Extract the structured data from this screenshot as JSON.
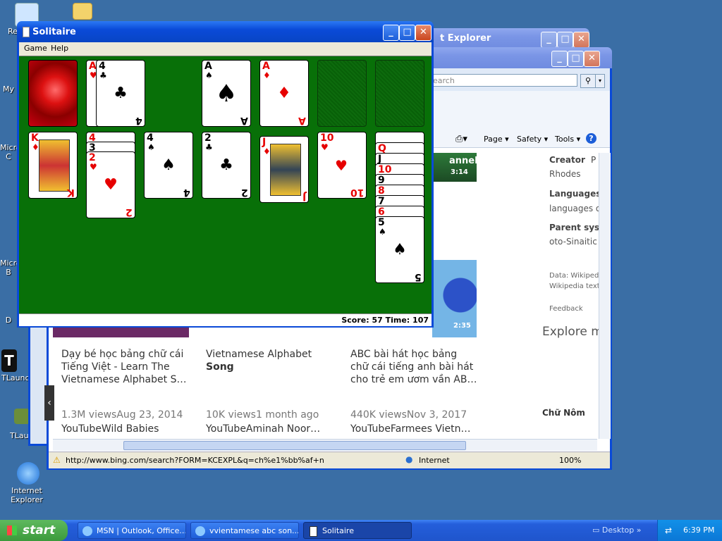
{
  "desktop": {
    "icons": [
      {
        "label": "Re"
      },
      {
        "label": "My"
      },
      {
        "label": "Micro C"
      },
      {
        "label": "Micro B"
      },
      {
        "label": "D"
      },
      {
        "label": "TLaunch"
      },
      {
        "label": "TLaunch"
      },
      {
        "label": "Internet Explorer"
      }
    ]
  },
  "ie_back": {
    "title": "t Explorer"
  },
  "ie_front": {
    "search_placeholder": "earch",
    "toolbar": {
      "page": "Page",
      "safety": "Safety",
      "tools": "Tools"
    },
    "side": {
      "creator_label": "Creator",
      "creator_value": "Rhodes",
      "creator_extra": "P",
      "languages_label": "Languages",
      "languages_value": "languages o",
      "parent_label": "Parent syst",
      "parent_value": "oto-Sinaitic",
      "data_line": "Data: Wikipedia",
      "wiki_line": "Wikipedia text",
      "feedback": "Feedback",
      "explore": "Explore m",
      "chu_nom": "Chữ Nôm"
    },
    "thumbs": [
      {
        "duration": "3:14",
        "text": "annel"
      },
      {
        "duration": "2:35"
      }
    ],
    "videos": [
      {
        "title1": "Dạy bé học bảng chữ cái",
        "title2": "Tiếng Việt - Learn The",
        "title3": "Vietnamese Alphabet S…",
        "meta": "1.3M viewsAug 23, 2014",
        "source": "YouTubeWild Babies"
      },
      {
        "title1": "Vietnamese Alphabet",
        "title2": "Song",
        "title3": "",
        "meta": "10K views1 month ago",
        "source": "YouTubeAminah Noor…"
      },
      {
        "title1": "ABC bài hát học bảng",
        "title2": "chữ cái tiếng anh bài hát",
        "title3": "cho trẻ em ươm vần AB…",
        "meta": "440K viewsNov 3, 2017",
        "source": "YouTubeFarmees Vietn…"
      }
    ],
    "status": {
      "url": "http://www.bing.com/search?FORM=KCEXPL&q=ch%e1%bb%af+n",
      "zone": "Internet",
      "zoom": "100%"
    }
  },
  "solitaire": {
    "title": "Solitaire",
    "menu": [
      "Game",
      "Help"
    ],
    "score": "Score: 57 Time: 107",
    "stock": {
      "top_rank": "A",
      "top_suit": "♥",
      "face_rank": "4",
      "face_suit": "♣"
    },
    "foundations": [
      {
        "rank": "A",
        "suit": "♠",
        "color": "#000000"
      },
      {
        "rank": "A",
        "suit": "♦",
        "color": "#e60000"
      }
    ],
    "tableau": [
      {
        "rank": "K",
        "suit": "♦",
        "color": "#e60000"
      },
      {
        "rank": "2",
        "suit": "♥",
        "color": "#e60000",
        "under": [
          "4",
          "3"
        ]
      },
      {
        "rank": "4",
        "suit": "♠",
        "color": "#000000"
      },
      {
        "rank": "2",
        "suit": "♣",
        "color": "#000000"
      },
      {
        "rank": "J",
        "suit": "♦",
        "color": "#e60000"
      },
      {
        "rank": "10",
        "suit": "♥",
        "color": "#e60000"
      },
      {
        "rank": "5",
        "suit": "♠",
        "color": "#000000",
        "under": [
          "Q",
          "J",
          "10",
          "9",
          "8",
          "7",
          "6"
        ]
      }
    ]
  },
  "taskbar": {
    "start": "start",
    "tasks": [
      "MSN | Outlook, Office...",
      "vvientamese abc son...",
      "Solitaire"
    ],
    "desktop_label": "Desktop",
    "clock": "6:39 PM"
  }
}
